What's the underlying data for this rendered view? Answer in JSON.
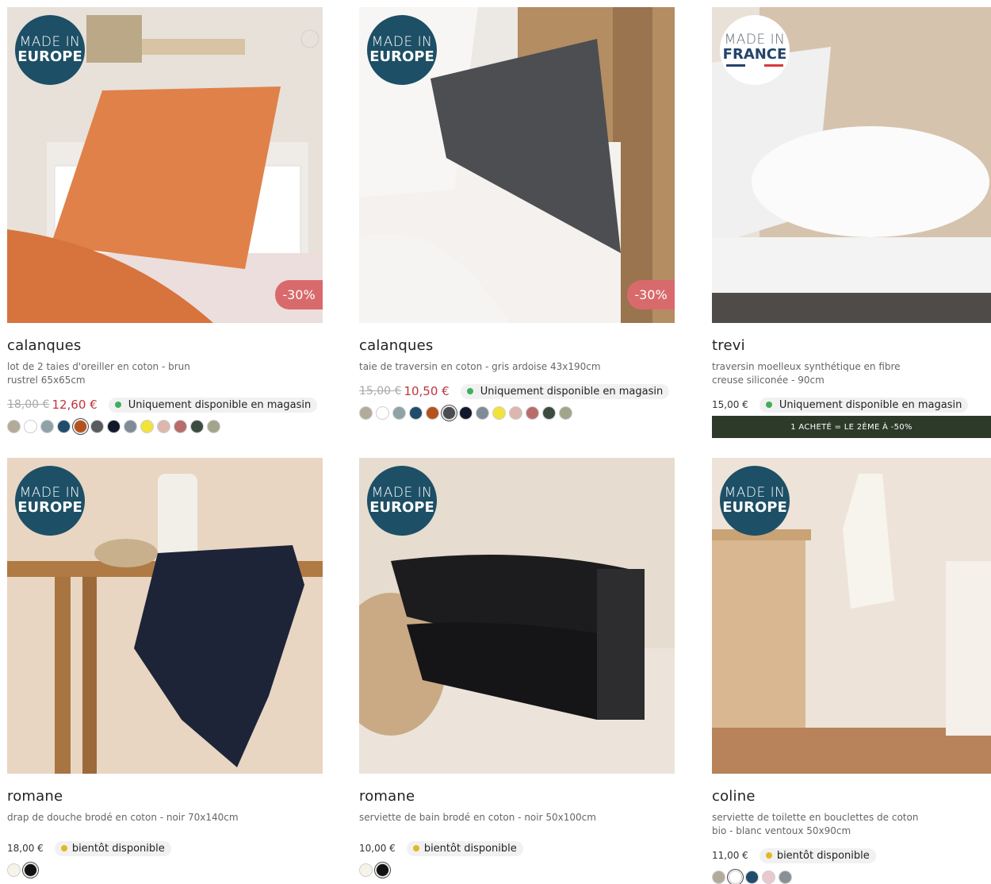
{
  "products": [
    {
      "name": "calanques",
      "description": "lot de 2 taies d'oreiller en coton - brun rustrel 65x65cm",
      "price_old": "18,00 €",
      "price_new": "12,60 €",
      "discount": "-30%",
      "availability": "Uniquement disponible en magasin",
      "origin_badge": {
        "line1": "MADE IN",
        "line2": "EUROPE"
      },
      "swatches": [
        "#b3ab99",
        "#ffffff",
        "#8fa2a8",
        "#1f4d6b",
        "#b5521c",
        "#595b5f",
        "#11182b",
        "#7f8c97",
        "#f2e33a",
        "#dcb7ae",
        "#b86d6c",
        "#3b4b3f",
        "#a3a48c"
      ],
      "selected_swatch": 4
    },
    {
      "name": "calanques",
      "description": "taie de traversin en coton - gris ardoise 43x190cm",
      "price_old": "15,00 €",
      "price_new": "10,50 €",
      "discount": "-30%",
      "availability": "Uniquement disponible en magasin",
      "origin_badge": {
        "line1": "MADE IN",
        "line2": "EUROPE"
      },
      "swatches": [
        "#b3ab99",
        "#ffffff",
        "#8fa2a8",
        "#1f4d6b",
        "#b5521c",
        "#4a4c50",
        "#11182b",
        "#7f8c97",
        "#f2e33a",
        "#dcb7ae",
        "#b86d6c",
        "#3b4b3f",
        "#a3a48c"
      ],
      "selected_swatch": 5
    },
    {
      "name": "trevi",
      "description": "traversin moelleux synthétique en fibre creuse siliconée - 90cm",
      "price": "15,00 €",
      "availability": "Uniquement disponible en magasin",
      "promo": "1 ACHETÉ = LE 2ÈME À -50%",
      "origin_badge": {
        "line1": "MADE IN",
        "line2": "FRANCE"
      }
    },
    {
      "name": "romane",
      "description": "drap de douche brodé en coton - noir 70x140cm",
      "price": "18,00 €",
      "availability": "bientôt disponible",
      "origin_badge": {
        "line1": "MADE IN",
        "line2": "EUROPE"
      },
      "swatches": [
        "#f6f4ea",
        "#111111"
      ],
      "selected_swatch": 1
    },
    {
      "name": "romane",
      "description": "serviette de bain brodé en coton - noir 50x100cm",
      "price": "10,00 €",
      "availability": "bientôt disponible",
      "origin_badge": {
        "line1": "MADE IN",
        "line2": "EUROPE"
      },
      "swatches": [
        "#f6f4ea",
        "#111111"
      ],
      "selected_swatch": 1
    },
    {
      "name": "coline",
      "description": "serviette de toilette en bouclettes de coton bio - blanc ventoux 50x90cm",
      "price": "11,00 €",
      "availability": "bientôt disponible",
      "origin_badge": {
        "line1": "MADE IN",
        "line2": "EUROPE"
      },
      "swatches": [
        "#b3ab99",
        "#ffffff",
        "#1f4d6b",
        "#e9c8cf",
        "#8a8f93"
      ],
      "selected_swatch": 1
    }
  ],
  "colors": {
    "badge_europe": "#1d4f66",
    "discount": "#d86a6c",
    "sale_price": "#c2343c",
    "promo_banner": "#2d3a29",
    "available_dot": "#3fae5b",
    "soon_dot": "#e3b820"
  }
}
